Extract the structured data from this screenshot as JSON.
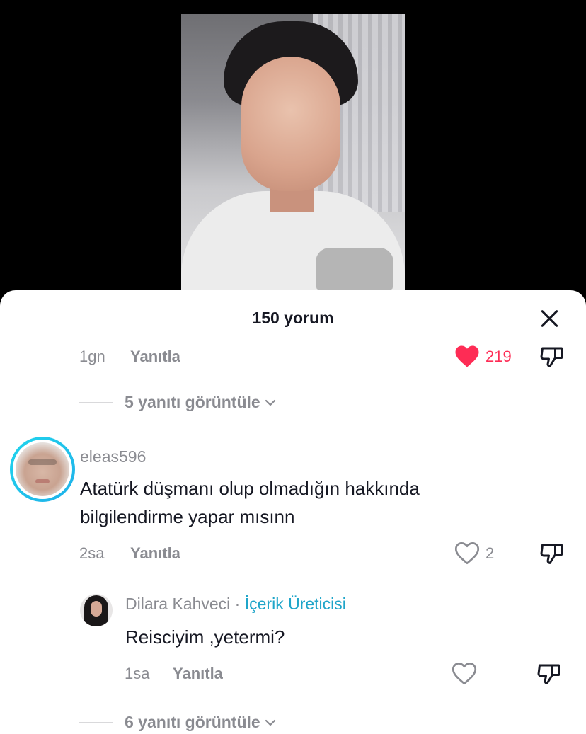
{
  "sheet": {
    "title": "150 yorum"
  },
  "top_comment_footer": {
    "time": "1gn",
    "reply_label": "Yanıtla",
    "likes": "219",
    "liked": true,
    "view_replies": "5 yanıtı görüntüle"
  },
  "comment": {
    "username": "eleas596",
    "text_line1": "Atatürk düşmanı olup olmadığın hakkında",
    "text_line2": "bilgilendirme yapar mısınn",
    "time": "2sa",
    "reply_label": "Yanıtla",
    "likes": "2"
  },
  "reply": {
    "username": "Dilara Kahveci",
    "separator": " · ",
    "badge": "İçerik Üreticisi",
    "text": "Reisciyim ,yetermi?",
    "time": "1sa",
    "reply_label": "Yanıtla"
  },
  "more_replies": {
    "label": "6 yanıtı görüntüle"
  },
  "colors": {
    "like_active": "#fe2c55",
    "muted_text": "#8a8b91",
    "creator_badge": "#1fa5c9",
    "avatar_ring": "#20d5ec"
  },
  "icons": [
    "close-icon",
    "heart-filled-icon",
    "heart-outline-icon",
    "dislike-icon",
    "chevron-down-icon"
  ]
}
